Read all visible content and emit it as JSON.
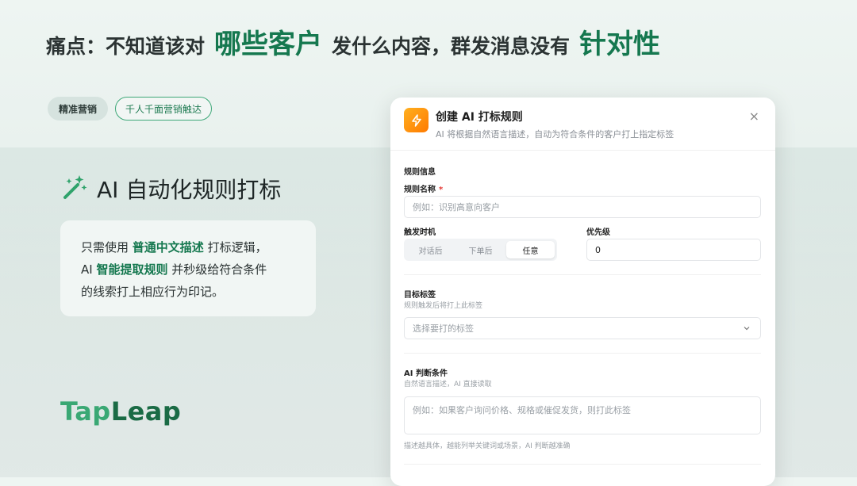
{
  "headline": {
    "part1": "痛点：不知道该对",
    "hl1": "哪些客户",
    "part2": "发什么内容，群发消息没有",
    "hl2": "针对性"
  },
  "pills": [
    "精准营销",
    "千人千面营销触达"
  ],
  "feature": {
    "title": "AI 自动化规则打标",
    "line1_a": "只需使用",
    "line1_hl": "普通中文描述",
    "line1_b": "打标逻辑，",
    "line2_a": "AI",
    "line2_hl": "智能提取规则",
    "line2_b": "并秒级给符合条件",
    "line3": "的线索打上相应行为印记。"
  },
  "logo": {
    "part1": "Tap",
    "part2": "Leap"
  },
  "modal": {
    "title": "创建 AI 打标规则",
    "subtitle": "AI 将根据自然语言描述，自动为符合条件的客户打上指定标签",
    "close": "×",
    "section_rule_info": "规则信息",
    "rule_name_label": "规则名称",
    "required_mark": "*",
    "rule_name_placeholder": "例如：识别高意向客户",
    "trigger_label": "触发时机",
    "trigger_options": [
      "对话后",
      "下单后",
      "任意"
    ],
    "priority_label": "优先级",
    "priority_value": "0",
    "target_tag_label": "目标标签",
    "target_tag_hint": "规则触发后将打上此标签",
    "target_tag_placeholder": "选择要打的标签",
    "ai_condition_label": "AI 判断条件",
    "ai_condition_hint": "自然语言描述，AI 直接读取",
    "ai_condition_placeholder": "例如：如果客户询问价格、规格或催促发货，则打此标签",
    "ai_condition_tip": "描述越具体，越能列举关键词或场景，AI 判断越准确"
  },
  "colors": {
    "accent": "#15784f",
    "brand_light": "#3aa874",
    "icon_orange": "#ff8a00"
  }
}
